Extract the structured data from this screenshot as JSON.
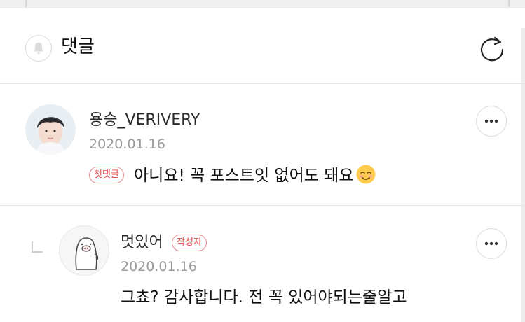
{
  "header": {
    "title": "댓글",
    "bell_icon": "bell-icon",
    "refresh_icon": "refresh-icon"
  },
  "comments": [
    {
      "author": "용승_VERIVERY",
      "date": "2020.01.16",
      "badge": "첫댓글",
      "text": "아니요! 꼭 포스트잇 없어도 돼요",
      "emoji": "smiling-face-emoji",
      "more_icon": "more-options-icon"
    },
    {
      "author": "멋있어",
      "date": "2020.01.16",
      "badge": "작성자",
      "text": "그쵸? 감사합니다. 전 꼭 있어야되는줄알고",
      "more_icon": "more-options-icon",
      "reply_icon": "reply-arrow-icon"
    }
  ],
  "colors": {
    "badge_red": "#e04b4b",
    "date_gray": "#9a9a9a",
    "divider": "#e4e4e4"
  }
}
